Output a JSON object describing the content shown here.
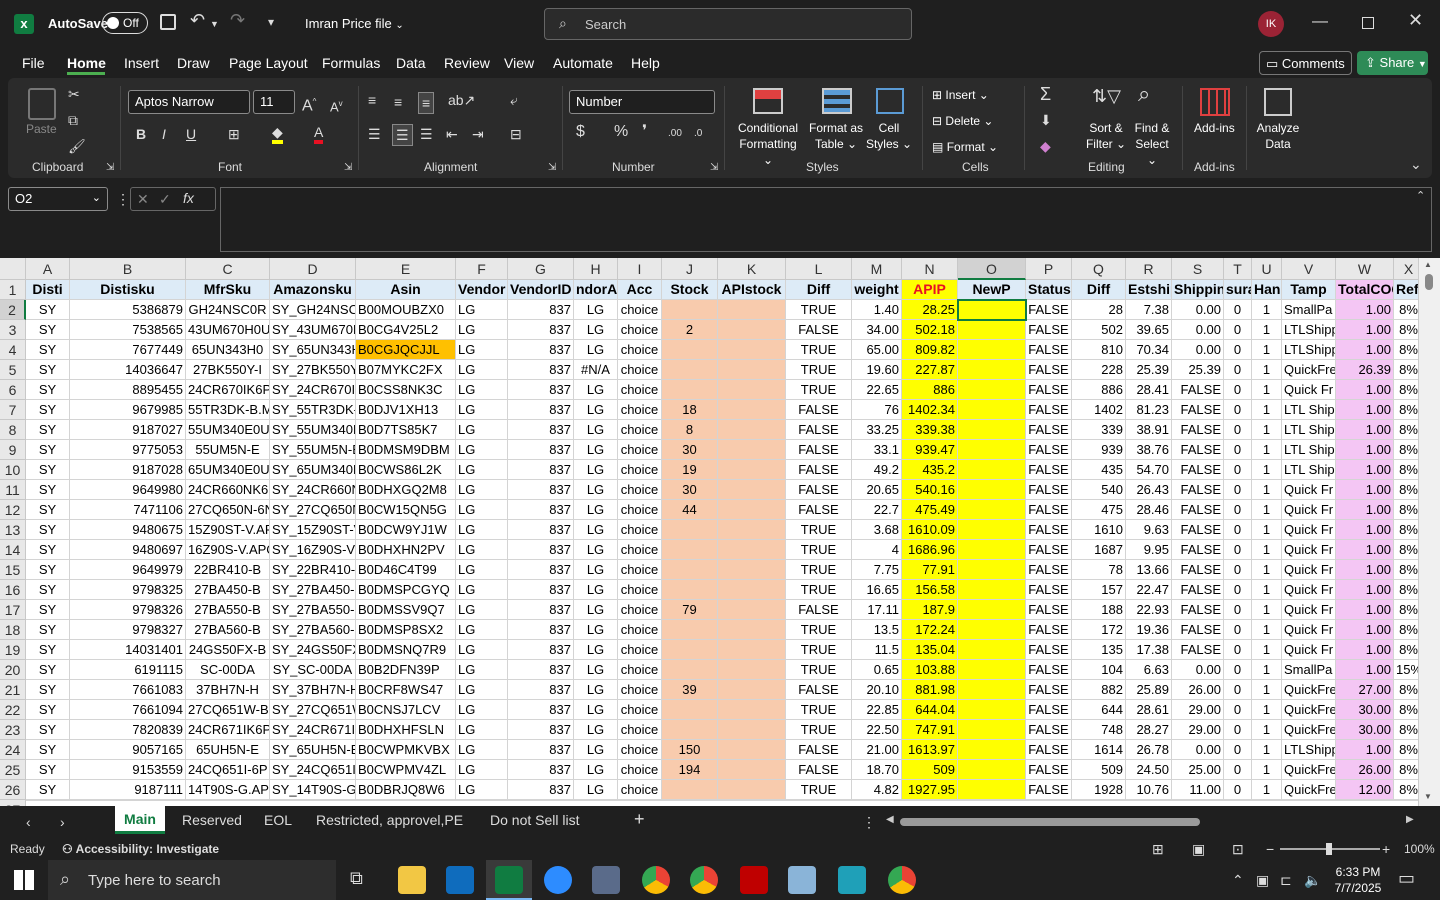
{
  "title": {
    "autosave": "AutoSave",
    "off": "Off",
    "filename": "Imran Price file",
    "search": "Search",
    "avatar": "IK"
  },
  "menu": [
    "File",
    "Home",
    "Insert",
    "Draw",
    "Page Layout",
    "Formulas",
    "Data",
    "Review",
    "View",
    "Automate",
    "Help"
  ],
  "comments": "Comments",
  "share": "Share",
  "ribbon": {
    "paste": "Paste",
    "clipboard": "Clipboard",
    "font_name": "Aptos Narrow",
    "font_size": "11",
    "font": "Font",
    "alignment": "Alignment",
    "numfmt": "Number",
    "number": "Number",
    "cond1": "Conditional",
    "cond2": "Formatting",
    "fmt1": "Format as",
    "fmt2": "Table",
    "cs1": "Cell",
    "cs2": "Styles",
    "styles": "Styles",
    "insert": "Insert",
    "delete": "Delete",
    "format": "Format",
    "cells": "Cells",
    "sort1": "Sort &",
    "sort2": "Filter",
    "find1": "Find &",
    "find2": "Select",
    "editing": "Editing",
    "addins": "Add-ins",
    "addins_grp": "Add-ins",
    "an1": "Analyze",
    "an2": "Data"
  },
  "namebox": "O2",
  "columns": [
    {
      "l": "A",
      "h": "Disti"
    },
    {
      "l": "B",
      "h": "Distisku"
    },
    {
      "l": "C",
      "h": "MfrSku"
    },
    {
      "l": "D",
      "h": "Amazonsku"
    },
    {
      "l": "E",
      "h": "Asin"
    },
    {
      "l": "F",
      "h": "Vendor"
    },
    {
      "l": "G",
      "h": "VendorID"
    },
    {
      "l": "H",
      "h": "ndorAll"
    },
    {
      "l": "I",
      "h": "Acc"
    },
    {
      "l": "J",
      "h": "Stock"
    },
    {
      "l": "K",
      "h": "APIstock"
    },
    {
      "l": "L",
      "h": "Diff"
    },
    {
      "l": "M",
      "h": "weight"
    },
    {
      "l": "N",
      "h": "APIP"
    },
    {
      "l": "O",
      "h": "NewP"
    },
    {
      "l": "P",
      "h": "Status"
    },
    {
      "l": "Q",
      "h": "Diff"
    },
    {
      "l": "R",
      "h": "Estship"
    },
    {
      "l": "S",
      "h": "Shippin"
    },
    {
      "l": "T",
      "h": "suran"
    },
    {
      "l": "U",
      "h": "Han"
    },
    {
      "l": "V",
      "h": "Tamp"
    },
    {
      "l": "W",
      "h": "TotalCOG"
    },
    {
      "l": "X",
      "h": "Reff"
    }
  ],
  "rows": [
    [
      "SY",
      "5386879",
      "GH24NSC0R",
      "SY_GH24NSC0",
      "B00MOUBZX0",
      "LG",
      "837",
      "LG",
      "choice",
      "",
      "",
      "TRUE",
      "1.40",
      "28.25",
      "",
      "FALSE",
      "28",
      "7.38",
      "0.00",
      "0",
      "1",
      "SmallPa",
      "1.00",
      "8%"
    ],
    [
      "SY",
      "7538565",
      "43UM670H0U",
      "SY_43UM670H",
      "B0CG4V25L2",
      "LG",
      "837",
      "LG",
      "choice",
      "2",
      "",
      "FALSE",
      "34.00",
      "502.18",
      "",
      "FALSE",
      "502",
      "39.65",
      "0.00",
      "0",
      "1",
      "LTLShipp",
      "1.00",
      "8%"
    ],
    [
      "SY",
      "7677449",
      "65UN343H0",
      "SY_65UN343H",
      "B0CGJQCJJL",
      "LG",
      "837",
      "LG",
      "choice",
      "",
      "",
      "TRUE",
      "65.00",
      "809.82",
      "",
      "FALSE",
      "810",
      "70.34",
      "0.00",
      "0",
      "1",
      "LTLShipp",
      "1.00",
      "8%"
    ],
    [
      "SY",
      "14036647",
      "27BK550Y-I",
      "SY_27BK550Y-",
      "B07MYKC2FX",
      "LG",
      "837",
      "#N/A",
      "choice",
      "",
      "",
      "TRUE",
      "19.60",
      "227.87",
      "",
      "FALSE",
      "228",
      "25.39",
      "25.39",
      "0",
      "1",
      "QuickFre",
      "26.39",
      "8%"
    ],
    [
      "SY",
      "8895455",
      "24CR670IK6P",
      "SY_24CR670IK",
      "B0CSS8NK3C",
      "LG",
      "837",
      "LG",
      "choice",
      "",
      "",
      "TRUE",
      "22.65",
      "886",
      "",
      "FALSE",
      "886",
      "28.41",
      "FALSE",
      "0",
      "1",
      "Quick Fr",
      "1.00",
      "8%"
    ],
    [
      "SY",
      "9679985",
      "55TR3DK-B.M",
      "SY_55TR3DK-B",
      "B0DJV1XH13",
      "LG",
      "837",
      "LG",
      "choice",
      "18",
      "",
      "FALSE",
      "76",
      "1402.34",
      "",
      "FALSE",
      "1402",
      "81.23",
      "FALSE",
      "0",
      "1",
      "LTL Shipi",
      "1.00",
      "8%"
    ],
    [
      "SY",
      "9187027",
      "55UM340E0U",
      "SY_55UM340E",
      "B0D7TS85K7",
      "LG",
      "837",
      "LG",
      "choice",
      "8",
      "",
      "FALSE",
      "33.25",
      "339.38",
      "",
      "FALSE",
      "339",
      "38.91",
      "FALSE",
      "0",
      "1",
      "LTL Shipi",
      "1.00",
      "8%"
    ],
    [
      "SY",
      "9775053",
      "55UM5N-E",
      "SY_55UM5N-E",
      "B0DMSM9DBM",
      "LG",
      "837",
      "LG",
      "choice",
      "30",
      "",
      "FALSE",
      "33.1",
      "939.47",
      "",
      "FALSE",
      "939",
      "38.76",
      "FALSE",
      "0",
      "1",
      "LTL Shipi",
      "1.00",
      "8%"
    ],
    [
      "SY",
      "9187028",
      "65UM340E0U",
      "SY_65UM340E",
      "B0CWS86L2K",
      "LG",
      "837",
      "LG",
      "choice",
      "19",
      "",
      "FALSE",
      "49.2",
      "435.2",
      "",
      "FALSE",
      "435",
      "54.70",
      "FALSE",
      "0",
      "1",
      "LTL Shipi",
      "1.00",
      "8%"
    ],
    [
      "SY",
      "9649980",
      "24CR660NK6F",
      "SY_24CR660N",
      "B0DHXGQ2M8",
      "LG",
      "837",
      "LG",
      "choice",
      "30",
      "",
      "FALSE",
      "20.65",
      "540.16",
      "",
      "FALSE",
      "540",
      "26.43",
      "FALSE",
      "0",
      "1",
      "Quick Fr",
      "1.00",
      "8%"
    ],
    [
      "SY",
      "7471106",
      "27CQ650N-6N",
      "SY_27CQ650N",
      "B0CW15QN5G",
      "LG",
      "837",
      "LG",
      "choice",
      "44",
      "",
      "FALSE",
      "22.7",
      "475.49",
      "",
      "FALSE",
      "475",
      "28.46",
      "FALSE",
      "0",
      "1",
      "Quick Fr",
      "1.00",
      "8%"
    ],
    [
      "SY",
      "9480675",
      "15Z90ST-V.AF",
      "SY_15Z90ST-V",
      "B0DCW9YJ1W",
      "LG",
      "837",
      "LG",
      "choice",
      "",
      "",
      "TRUE",
      "3.68",
      "1610.09",
      "",
      "FALSE",
      "1610",
      "9.63",
      "FALSE",
      "0",
      "1",
      "Quick Fr",
      "1.00",
      "8%"
    ],
    [
      "SY",
      "9480697",
      "16Z90S-V.APC",
      "SY_16Z90S-V.",
      "B0DHXHN2PV",
      "LG",
      "837",
      "LG",
      "choice",
      "",
      "",
      "TRUE",
      "4",
      "1686.96",
      "",
      "FALSE",
      "1687",
      "9.95",
      "FALSE",
      "0",
      "1",
      "Quick Fr",
      "1.00",
      "8%"
    ],
    [
      "SY",
      "9649979",
      "22BR410-B",
      "SY_22BR410-B",
      "B0D46C4T99",
      "LG",
      "837",
      "LG",
      "choice",
      "",
      "",
      "TRUE",
      "7.75",
      "77.91",
      "",
      "FALSE",
      "78",
      "13.66",
      "FALSE",
      "0",
      "1",
      "Quick Fr",
      "1.00",
      "8%"
    ],
    [
      "SY",
      "9798325",
      "27BA450-B",
      "SY_27BA450-E",
      "B0DMSPCGYQ",
      "LG",
      "837",
      "LG",
      "choice",
      "",
      "",
      "TRUE",
      "16.65",
      "156.58",
      "",
      "FALSE",
      "157",
      "22.47",
      "FALSE",
      "0",
      "1",
      "Quick Fr",
      "1.00",
      "8%"
    ],
    [
      "SY",
      "9798326",
      "27BA550-B",
      "SY_27BA550-E",
      "B0DMSSV9Q7",
      "LG",
      "837",
      "LG",
      "choice",
      "79",
      "",
      "FALSE",
      "17.11",
      "187.9",
      "",
      "FALSE",
      "188",
      "22.93",
      "FALSE",
      "0",
      "1",
      "Quick Fr",
      "1.00",
      "8%"
    ],
    [
      "SY",
      "9798327",
      "27BA560-B",
      "SY_27BA560-E",
      "B0DMSP8SX2",
      "LG",
      "837",
      "LG",
      "choice",
      "",
      "",
      "TRUE",
      "13.5",
      "172.24",
      "",
      "FALSE",
      "172",
      "19.36",
      "FALSE",
      "0",
      "1",
      "Quick Fr",
      "1.00",
      "8%"
    ],
    [
      "SY",
      "14031401",
      "24GS50FX-B",
      "SY_24GS50FX-",
      "B0DMSNQ7R9",
      "LG",
      "837",
      "LG",
      "choice",
      "",
      "",
      "TRUE",
      "11.5",
      "135.04",
      "",
      "FALSE",
      "135",
      "17.38",
      "FALSE",
      "0",
      "1",
      "Quick Fr",
      "1.00",
      "8%"
    ],
    [
      "SY",
      "6191115",
      "SC-00DA",
      "SY_SC-00DA",
      "B0B2DFN39P",
      "LG",
      "837",
      "LG",
      "choice",
      "",
      "",
      "TRUE",
      "0.65",
      "103.88",
      "",
      "FALSE",
      "104",
      "6.63",
      "0.00",
      "0",
      "1",
      "SmallPa",
      "1.00",
      "15%"
    ],
    [
      "SY",
      "7661083",
      "37BH7N-H",
      "SY_37BH7N-H",
      "B0CRF8WS47",
      "LG",
      "837",
      "LG",
      "choice",
      "39",
      "",
      "FALSE",
      "20.10",
      "881.98",
      "",
      "FALSE",
      "882",
      "25.89",
      "26.00",
      "0",
      "1",
      "QuickFre",
      "27.00",
      "8%"
    ],
    [
      "SY",
      "7661094",
      "27CQ651W-B",
      "SY_27CQ651W",
      "B0CNSJ7LCV",
      "LG",
      "837",
      "LG",
      "choice",
      "",
      "",
      "TRUE",
      "22.85",
      "644.04",
      "",
      "FALSE",
      "644",
      "28.61",
      "29.00",
      "0",
      "1",
      "QuickFre",
      "30.00",
      "8%"
    ],
    [
      "SY",
      "7820839",
      "24CR671IK6P",
      "SY_24CR671IK",
      "B0DHXHFSLN",
      "LG",
      "837",
      "LG",
      "choice",
      "",
      "",
      "TRUE",
      "22.50",
      "747.91",
      "",
      "FALSE",
      "748",
      "28.27",
      "29.00",
      "0",
      "1",
      "QuickFre",
      "30.00",
      "8%"
    ],
    [
      "SY",
      "9057165",
      "65UH5N-E",
      "SY_65UH5N-E",
      "B0CWPMKVBX",
      "LG",
      "837",
      "LG",
      "choice",
      "150",
      "",
      "FALSE",
      "21.00",
      "1613.97",
      "",
      "FALSE",
      "1614",
      "26.78",
      "0.00",
      "0",
      "1",
      "LTLShipp",
      "1.00",
      "8%"
    ],
    [
      "SY",
      "9153559",
      "24CQ651I-6P",
      "SY_24CQ651I-",
      "B0CWPMV4ZL",
      "LG",
      "837",
      "LG",
      "choice",
      "194",
      "",
      "FALSE",
      "18.70",
      "509",
      "",
      "FALSE",
      "509",
      "24.50",
      "25.00",
      "0",
      "1",
      "QuickFre",
      "26.00",
      "8%"
    ],
    [
      "SY",
      "9187111",
      "14T90S-G.APE",
      "SY_14T90S-G.",
      "B0DBRJQ8W6",
      "LG",
      "837",
      "LG",
      "choice",
      "",
      "",
      "TRUE",
      "4.82",
      "1927.95",
      "",
      "FALSE",
      "1928",
      "10.76",
      "11.00",
      "0",
      "1",
      "QuickFre",
      "12.00",
      "8%"
    ]
  ],
  "sheets": [
    "Main",
    "Reserved",
    "EOL",
    "Restricted, approvel,PE",
    "Do not Sell list"
  ],
  "status": {
    "ready": "Ready",
    "accessibility": "Accessibility: Investigate",
    "zoom": "100%"
  },
  "taskbar": {
    "search": "Type here to search",
    "time": "6:33 PM",
    "date": "7/7/2025"
  }
}
